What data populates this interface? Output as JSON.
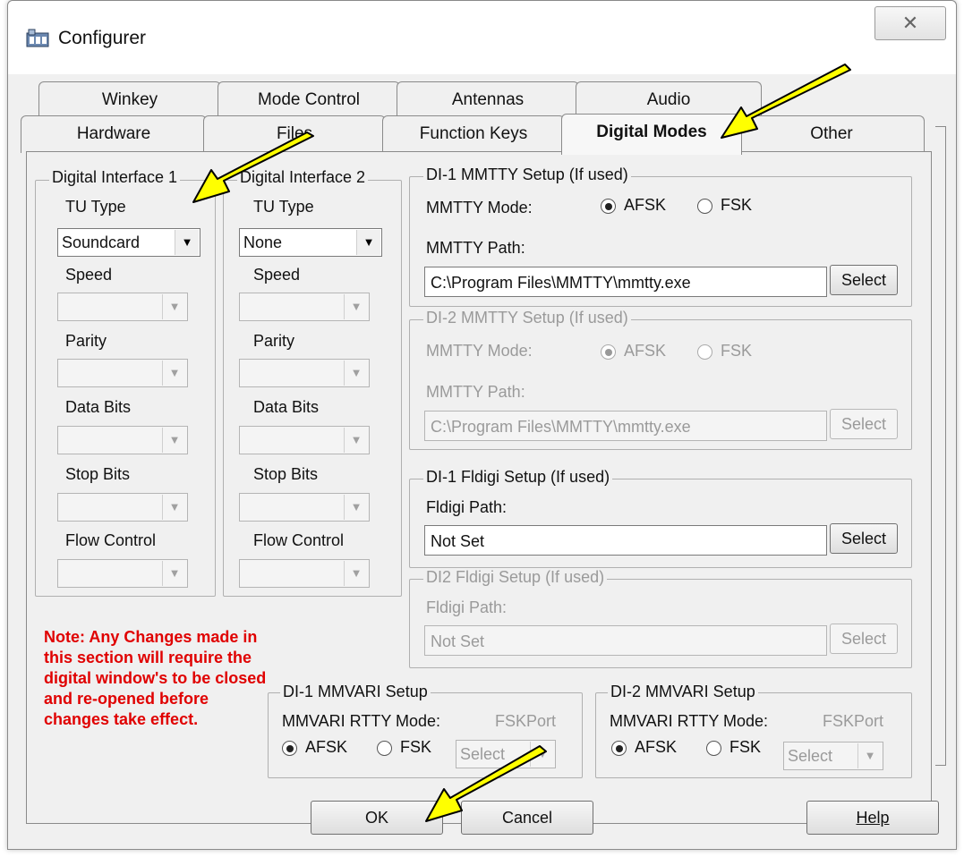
{
  "window": {
    "title": "Configurer",
    "close_icon": "close-icon"
  },
  "tabs": {
    "row_back": [
      "Winkey",
      "Mode Control",
      "Antennas",
      "Audio"
    ],
    "row_front": [
      "Hardware",
      "Files",
      "Function Keys",
      "Digital Modes",
      "Other"
    ],
    "active": "Digital Modes"
  },
  "di1": {
    "group_label": "Digital Interface 1",
    "tu_type_label": "TU Type",
    "tu_type_value": "Soundcard",
    "speed_label": "Speed",
    "parity_label": "Parity",
    "data_bits_label": "Data Bits",
    "stop_bits_label": "Stop Bits",
    "flow_control_label": "Flow Control"
  },
  "di2": {
    "group_label": "Digital Interface 2",
    "tu_type_label": "TU Type",
    "tu_type_value": "None",
    "speed_label": "Speed",
    "parity_label": "Parity",
    "data_bits_label": "Data Bits",
    "stop_bits_label": "Stop Bits",
    "flow_control_label": "Flow Control"
  },
  "mmtty1": {
    "group_label": "DI-1 MMTTY Setup (If used)",
    "mode_label": "MMTTY Mode:",
    "afsk": "AFSK",
    "fsk": "FSK",
    "path_label": "MMTTY Path:",
    "path_value": "C:\\Program Files\\MMTTY\\mmtty.exe",
    "select": "Select"
  },
  "mmtty2": {
    "group_label": "DI-2 MMTTY Setup (If used)",
    "mode_label": "MMTTY Mode:",
    "afsk": "AFSK",
    "fsk": "FSK",
    "path_label": "MMTTY Path:",
    "path_value": "C:\\Program Files\\MMTTY\\mmtty.exe",
    "select": "Select"
  },
  "fldigi1": {
    "group_label": "DI-1 Fldigi Setup (If used)",
    "path_label": "Fldigi Path:",
    "path_value": "Not Set",
    "select": "Select"
  },
  "fldigi2": {
    "group_label": "DI2 Fldigi Setup (If used)",
    "path_label": "Fldigi Path:",
    "path_value": "Not Set",
    "select": "Select"
  },
  "note": "Note: Any Changes made in this section will require the digital window's to be closed and re-opened before changes take effect.",
  "mmvari1": {
    "group_label": "DI-1 MMVARI Setup",
    "mode_label": "MMVARI RTTY Mode:",
    "fskport_label": "FSKPort",
    "afsk": "AFSK",
    "fsk": "FSK",
    "select": "Select"
  },
  "mmvari2": {
    "group_label": "DI-2 MMVARI Setup",
    "mode_label": "MMVARI RTTY Mode:",
    "fskport_label": "FSKPort",
    "afsk": "AFSK",
    "fsk": "FSK",
    "select": "Select"
  },
  "buttons": {
    "ok": "OK",
    "cancel": "Cancel",
    "help": "Help"
  },
  "colors": {
    "note_red": "#e00000",
    "arrow_yellow": "#ffff00"
  }
}
